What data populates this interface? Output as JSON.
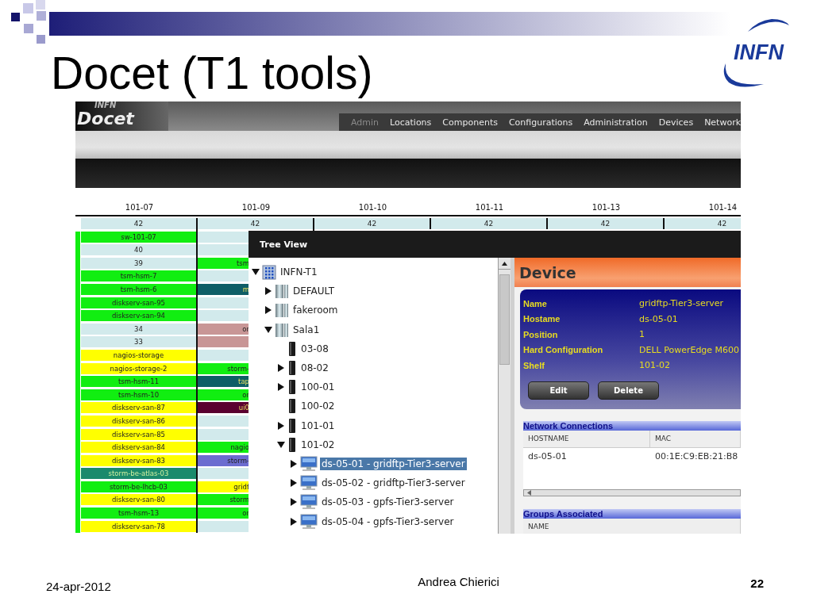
{
  "slide": {
    "title": "Docet (T1 tools)",
    "logo": "INFN",
    "date": "24-apr-2012",
    "author": "Andrea Chierici",
    "page": "22"
  },
  "app": {
    "logo": {
      "small": "INFN",
      "name": "Docet"
    },
    "nav": [
      {
        "label": "Admin",
        "selected": true
      },
      {
        "label": "Locations",
        "selected": false
      },
      {
        "label": "Components",
        "selected": false
      },
      {
        "label": "Configurations",
        "selected": false
      },
      {
        "label": "Administration",
        "selected": false
      },
      {
        "label": "Devices",
        "selected": false
      },
      {
        "label": "Network",
        "selected": false
      }
    ],
    "columns": [
      {
        "label": "101-07",
        "total": "42"
      },
      {
        "label": "101-09",
        "total": "42"
      },
      {
        "label": "101-10",
        "total": "42"
      },
      {
        "label": "101-11",
        "total": "42"
      },
      {
        "label": "101-13",
        "total": "42"
      },
      {
        "label": "101-14",
        "total": "42"
      }
    ],
    "column_1_cells": [
      {
        "text": "sw-101-07",
        "color": "#11ee11"
      },
      {
        "text": "40",
        "color": "#d2eaec"
      },
      {
        "text": "39",
        "color": "#d2eaec"
      },
      {
        "text": "tsm-hsm-7",
        "color": "#11ee11"
      },
      {
        "text": "tsm-hsm-6",
        "color": "#11ee11"
      },
      {
        "text": "diskserv-san-95",
        "color": "#11ee11"
      },
      {
        "text": "diskserv-san-94",
        "color": "#11ee11"
      },
      {
        "text": "34",
        "color": "#d2eaec"
      },
      {
        "text": "33",
        "color": "#d2eaec"
      },
      {
        "text": "nagios-storage",
        "color": "#ffff00"
      },
      {
        "text": "nagios-storage-2",
        "color": "#ffff00"
      },
      {
        "text": "tsm-hsm-11",
        "color": "#11ee11"
      },
      {
        "text": "tsm-hsm-10",
        "color": "#11ee11"
      },
      {
        "text": "diskserv-san-87",
        "color": "#ffff00"
      },
      {
        "text": "diskserv-san-86",
        "color": "#ffff00"
      },
      {
        "text": "diskserv-san-85",
        "color": "#ffff00"
      },
      {
        "text": "diskserv-san-84",
        "color": "#ffff00"
      },
      {
        "text": "diskserv-san-83",
        "color": "#ffff00"
      },
      {
        "text": "storm-be-atlas-03",
        "color": "#1a8a6c"
      },
      {
        "text": "storm-be-lhcb-03",
        "color": "#11ee11"
      },
      {
        "text": "diskserv-san-80",
        "color": "#ffff00"
      },
      {
        "text": "tsm-hsm-13",
        "color": "#11ee11"
      },
      {
        "text": "diskserv-san-78",
        "color": "#ffff00"
      }
    ],
    "column_2_cells": [
      {
        "color": "#d2eaec"
      },
      {
        "color": "#d2eaec"
      },
      {
        "text": "tsm",
        "color": "#11ee11"
      },
      {
        "color": "#d2eaec"
      },
      {
        "text": "m",
        "color": "#0e5e66"
      },
      {
        "color": "#d2eaec"
      },
      {
        "color": "#d2eaec"
      },
      {
        "text": "or",
        "color": "#c89696"
      },
      {
        "color": "#c89696"
      },
      {
        "color": "#d2eaec"
      },
      {
        "text": "storm-",
        "color": "#11ee11"
      },
      {
        "text": "tap",
        "color": "#0e5e66"
      },
      {
        "text": "or",
        "color": "#11ee11"
      },
      {
        "text": "ui0",
        "color": "#5a0030"
      },
      {
        "color": "#d2eaec"
      },
      {
        "color": "#d2eaec"
      },
      {
        "text": "nagio",
        "color": "#11ee11"
      },
      {
        "text": "storm-",
        "color": "#6c6cd0"
      },
      {
        "color": "#d2eaec"
      },
      {
        "text": "gridf",
        "color": "#ffff00"
      },
      {
        "text": "storm",
        "color": "#11ee11"
      },
      {
        "text": "or",
        "color": "#11ee11"
      },
      {
        "color": "#d2eaec"
      }
    ],
    "tree_window": {
      "title": "Tree View",
      "tree": [
        {
          "label": "INFN-T1",
          "kind": "building",
          "leaf": false,
          "expanded": true,
          "selected": false,
          "children": [
            {
              "label": "DEFAULT",
              "kind": "room",
              "leaf": false,
              "expanded": false,
              "selected": false
            },
            {
              "label": "fakeroom",
              "kind": "room",
              "leaf": false,
              "expanded": false,
              "selected": false
            },
            {
              "label": "Sala1",
              "kind": "room",
              "leaf": false,
              "expanded": true,
              "selected": false,
              "children": [
                {
                  "label": "03-08",
                  "kind": "rack",
                  "leaf": true,
                  "selected": false
                },
                {
                  "label": "08-02",
                  "kind": "rack",
                  "leaf": false,
                  "expanded": false,
                  "selected": false
                },
                {
                  "label": "100-01",
                  "kind": "rack",
                  "leaf": false,
                  "expanded": false,
                  "selected": false
                },
                {
                  "label": "100-02",
                  "kind": "rack",
                  "leaf": true,
                  "selected": false
                },
                {
                  "label": "101-01",
                  "kind": "rack",
                  "leaf": false,
                  "expanded": false,
                  "selected": false
                },
                {
                  "label": "101-02",
                  "kind": "rack",
                  "leaf": false,
                  "expanded": true,
                  "selected": false,
                  "children": [
                    {
                      "label": "ds-05-01 - gridftp-Tier3-server",
                      "kind": "server",
                      "leaf": false,
                      "expanded": false,
                      "selected": true
                    },
                    {
                      "label": "ds-05-02 - gridftp-Tier3-server",
                      "kind": "server",
                      "leaf": false,
                      "expanded": false,
                      "selected": false
                    },
                    {
                      "label": "ds-05-03 - gpfs-Tier3-server",
                      "kind": "server",
                      "leaf": false,
                      "expanded": false,
                      "selected": false
                    },
                    {
                      "label": "ds-05-04 - gpfs-Tier3-server",
                      "kind": "server",
                      "leaf": false,
                      "expanded": false,
                      "selected": false
                    }
                  ]
                }
              ]
            }
          ]
        }
      ]
    },
    "device": {
      "title": "Device",
      "fields": [
        {
          "label": "Name",
          "value": "gridftp-Tier3-server"
        },
        {
          "label": "Hostame",
          "value": "ds-05-01"
        },
        {
          "label": "Position",
          "value": "1"
        },
        {
          "label": "Hard Configuration",
          "value": "DELL PowerEdge M600"
        },
        {
          "label": "Shelf",
          "value": "101-02"
        }
      ],
      "buttons": [
        "Edit",
        "Delete"
      ]
    },
    "network_connections": {
      "title": "Network Connections",
      "columns": [
        "HOSTNAME",
        "MAC"
      ],
      "rows": [
        [
          "ds-05-01",
          "00:1E:C9:EB:21:B8"
        ]
      ]
    },
    "groups_associated": {
      "title": "Groups Associated",
      "columns": [
        "NAME"
      ]
    }
  }
}
